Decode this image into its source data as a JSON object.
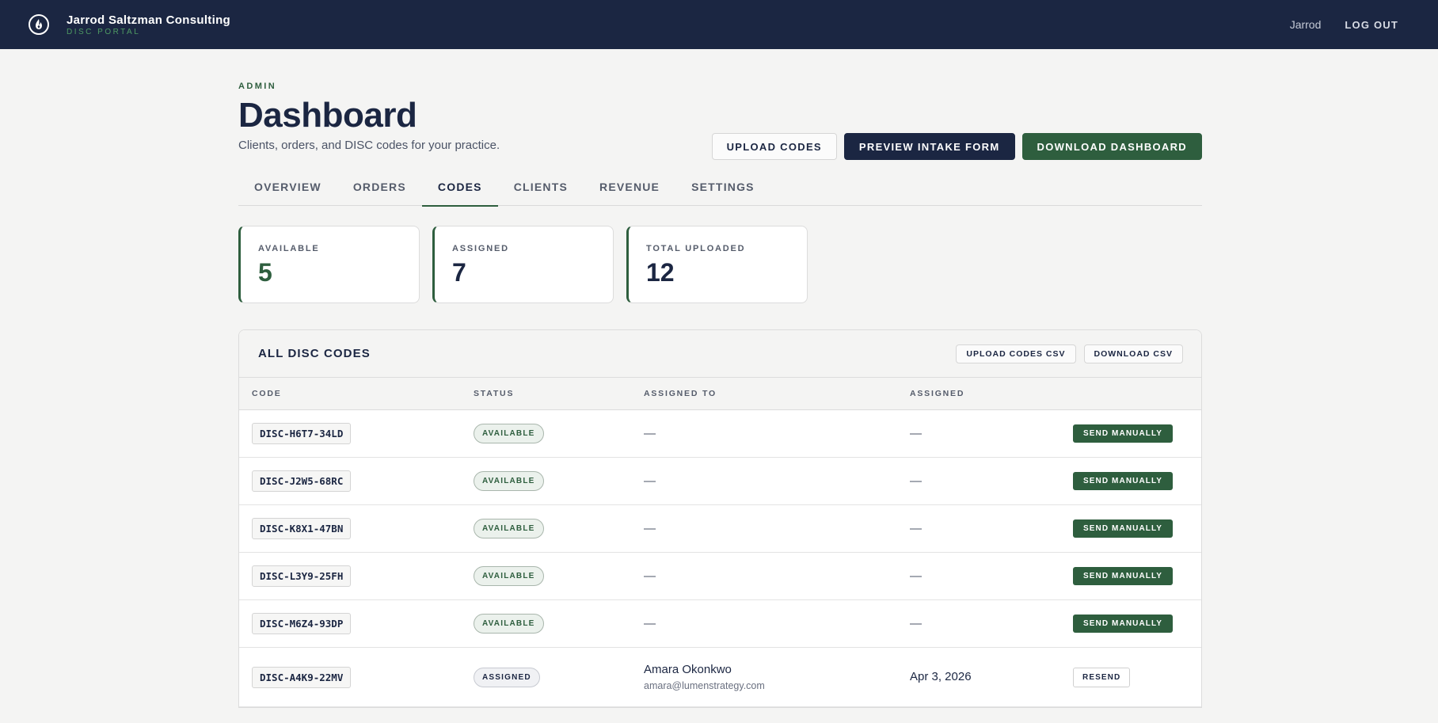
{
  "brand": {
    "name": "Jarrod Saltzman Consulting",
    "subtitle": "DISC PORTAL",
    "logo_icon": "flame-logo-icon"
  },
  "topnav": {
    "user": "Jarrod",
    "logout": "LOG OUT"
  },
  "header": {
    "eyebrow": "ADMIN",
    "title": "Dashboard",
    "subtitle": "Clients, orders, and DISC codes for your practice.",
    "upload_codes": "UPLOAD CODES",
    "preview_intake": "PREVIEW INTAKE FORM",
    "download_dashboard": "DOWNLOAD DASHBOARD"
  },
  "tabs": [
    {
      "label": "OVERVIEW"
    },
    {
      "label": "ORDERS"
    },
    {
      "label": "CODES",
      "active": true
    },
    {
      "label": "CLIENTS"
    },
    {
      "label": "REVENUE"
    },
    {
      "label": "SETTINGS"
    }
  ],
  "stats": [
    {
      "label": "AVAILABLE",
      "value": "5"
    },
    {
      "label": "ASSIGNED",
      "value": "7"
    },
    {
      "label": "TOTAL UPLOADED",
      "value": "12"
    }
  ],
  "codes_panel": {
    "title": "ALL DISC CODES",
    "upload_csv": "UPLOAD CODES CSV",
    "download_csv": "DOWNLOAD CSV",
    "columns": {
      "code": "CODE",
      "status": "STATUS",
      "assigned_to": "ASSIGNED TO",
      "assigned": "ASSIGNED"
    },
    "rows": [
      {
        "code": "DISC-H6T7-34LD",
        "status": "AVAILABLE",
        "assignee": "—",
        "date": "—",
        "action": "SEND MANUALLY"
      },
      {
        "code": "DISC-J2W5-68RC",
        "status": "AVAILABLE",
        "assignee": "—",
        "date": "—",
        "action": "SEND MANUALLY"
      },
      {
        "code": "DISC-K8X1-47BN",
        "status": "AVAILABLE",
        "assignee": "—",
        "date": "—",
        "action": "SEND MANUALLY"
      },
      {
        "code": "DISC-L3Y9-25FH",
        "status": "AVAILABLE",
        "assignee": "—",
        "date": "—",
        "action": "SEND MANUALLY"
      },
      {
        "code": "DISC-M6Z4-93DP",
        "status": "AVAILABLE",
        "assignee": "—",
        "date": "—",
        "action": "SEND MANUALLY"
      },
      {
        "code": "DISC-A4K9-22MV",
        "status": "ASSIGNED",
        "assignee_name": "Amara Okonkwo",
        "assignee_email": "amara@lumenstrategy.com",
        "date": "Apr 3, 2026",
        "action": "RESEND"
      }
    ]
  },
  "colors": {
    "navy": "#1b2642",
    "green": "#2e5e3e",
    "background": "#f4f4f3"
  }
}
